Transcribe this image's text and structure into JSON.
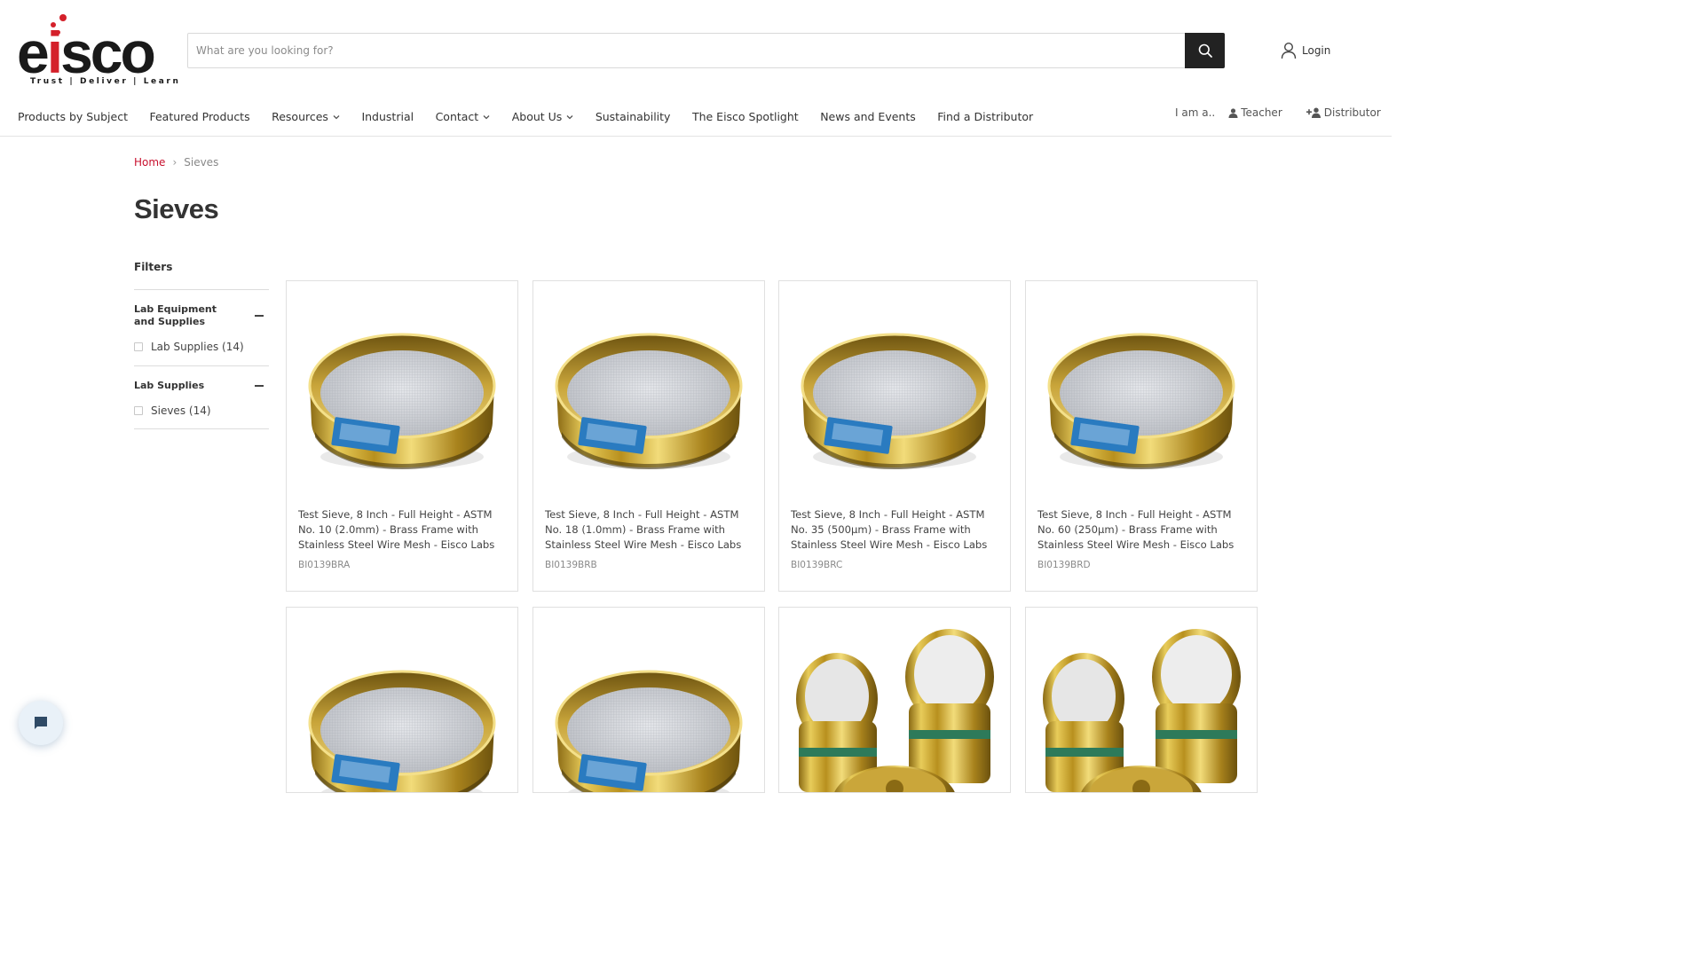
{
  "brand": {
    "logo_text_before": "e",
    "logo_text_i": "i",
    "logo_text_after": "sco",
    "tagline": "Trust | Deliver | Learn",
    "accent_color": "#d4202a"
  },
  "search": {
    "placeholder": "What are you looking for?",
    "value": ""
  },
  "account": {
    "login_label": "Login"
  },
  "nav": {
    "items": [
      {
        "label": "Products by Subject",
        "dropdown": false
      },
      {
        "label": "Featured Products",
        "dropdown": false
      },
      {
        "label": "Resources",
        "dropdown": true
      },
      {
        "label": "Industrial",
        "dropdown": false
      },
      {
        "label": "Contact",
        "dropdown": true
      },
      {
        "label": "About Us",
        "dropdown": true
      },
      {
        "label": "Sustainability",
        "dropdown": false
      },
      {
        "label": "The Eisco Spotlight",
        "dropdown": false
      },
      {
        "label": "News and Events",
        "dropdown": false
      },
      {
        "label": "Find a Distributor",
        "dropdown": false
      }
    ]
  },
  "audience": {
    "label": "I am a..",
    "teacher": "Teacher",
    "distributor": "Distributor"
  },
  "breadcrumb": {
    "home": "Home",
    "separator": "›",
    "current": "Sieves"
  },
  "page": {
    "title": "Sieves"
  },
  "filters": {
    "title": "Filters",
    "groups": [
      {
        "title": "Lab Equipment and Supplies",
        "options": [
          {
            "label": "Lab Supplies (14)",
            "checked": false
          }
        ]
      },
      {
        "title": "Lab Supplies",
        "options": [
          {
            "label": "Sieves (14)",
            "checked": false
          }
        ]
      }
    ]
  },
  "products": [
    {
      "title": "Test Sieve, 8 Inch - Full Height - ASTM No. 10 (2.0mm) - Brass Frame with Stainless Steel Wire Mesh - Eisco Labs",
      "sku": "BI0139BRA",
      "image": "brass-sieve"
    },
    {
      "title": "Test Sieve, 8 Inch - Full Height - ASTM No. 18 (1.0mm) - Brass Frame with Stainless Steel Wire Mesh - Eisco Labs",
      "sku": "BI0139BRB",
      "image": "brass-sieve"
    },
    {
      "title": "Test Sieve, 8 Inch - Full Height - ASTM No. 35 (500µm) - Brass Frame with Stainless Steel Wire Mesh - Eisco Labs",
      "sku": "BI0139BRC",
      "image": "brass-sieve"
    },
    {
      "title": "Test Sieve, 8 Inch - Full Height - ASTM No. 60 (250µm) - Brass Frame with Stainless Steel Wire Mesh - Eisco Labs",
      "sku": "BI0139BRD",
      "image": "brass-sieve"
    },
    {
      "title": "",
      "sku": "",
      "image": "brass-sieve"
    },
    {
      "title": "",
      "sku": "",
      "image": "brass-sieve"
    },
    {
      "title": "",
      "sku": "",
      "image": "sieve-set"
    },
    {
      "title": "",
      "sku": "",
      "image": "sieve-set"
    }
  ],
  "chat": {
    "icon": "chat-bubble-icon"
  }
}
